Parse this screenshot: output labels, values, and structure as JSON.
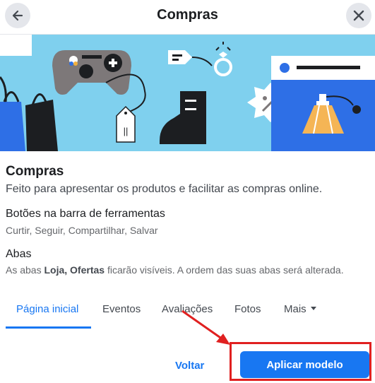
{
  "header": {
    "title": "Compras",
    "back_icon": "arrow-left-icon",
    "close_icon": "close-icon"
  },
  "banner": {
    "tag_text": "||",
    "colors": {
      "sky": "#7fd0ee",
      "blue": "#2e6fe6",
      "dark": "#1c1e21",
      "controller": "#7d7879"
    }
  },
  "template": {
    "title": "Compras",
    "description": "Feito para apresentar os produtos e facilitar as compras online."
  },
  "toolbar_buttons": {
    "heading": "Botões na barra de ferramentas",
    "items": "Curtir, Seguir, Compartilhar, Salvar"
  },
  "tabs_section": {
    "heading": "Abas",
    "desc_prefix": "As abas ",
    "desc_bold": "Loja, Ofertas",
    "desc_suffix": " ficarão visíveis. A ordem das suas abas será alterada."
  },
  "tabs": [
    {
      "label": "Página inicial",
      "active": true
    },
    {
      "label": "Eventos"
    },
    {
      "label": "Avaliações"
    },
    {
      "label": "Fotos"
    },
    {
      "label": "Mais"
    }
  ],
  "actions": {
    "back_label": "Voltar",
    "apply_label": "Aplicar modelo"
  },
  "annotation": {
    "color": "#e02020"
  }
}
